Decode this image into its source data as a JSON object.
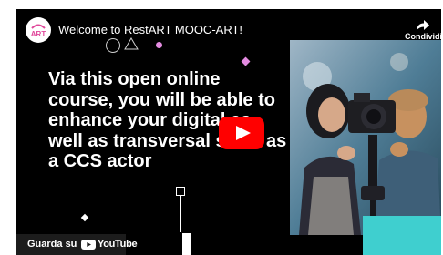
{
  "video": {
    "title": "Welcome to RestART MOOC-ART!",
    "headline": "Via this open online course, you will be able to enhance your digital as well as transversal skills as a CCS actor",
    "share_label": "Condividi",
    "watch_on_label": "Guarda su",
    "youtube_label": "YouTube",
    "channel_logo_text": "ART"
  },
  "icons": {
    "share": "share-arrow-icon",
    "play": "youtube-play-icon",
    "youtube_logo": "youtube-logo-icon"
  },
  "colors": {
    "accent_pink": "#e38be0",
    "play_red": "#ff0000",
    "teal": "#3fcfcf",
    "background": "#000000"
  }
}
